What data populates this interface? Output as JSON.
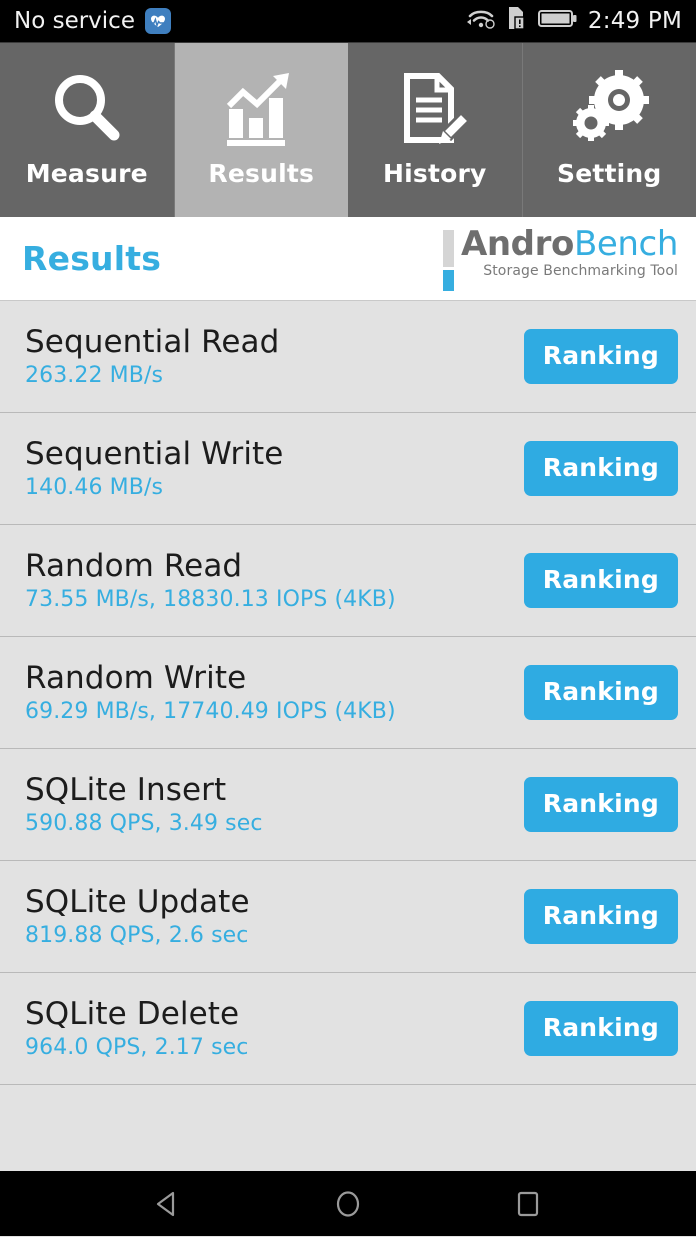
{
  "status_bar": {
    "carrier": "No service",
    "time": "2:49 PM",
    "icons": [
      "heart-rate-badge-icon",
      "wifi-icon",
      "sim-alert-icon",
      "battery-icon"
    ]
  },
  "tabs": [
    {
      "label": "Measure",
      "icon": "magnifier-icon",
      "active": false
    },
    {
      "label": "Results",
      "icon": "bar-chart-trend-icon",
      "active": true
    },
    {
      "label": "History",
      "icon": "document-pencil-icon",
      "active": false
    },
    {
      "label": "Setting",
      "icon": "gears-icon",
      "active": false
    }
  ],
  "header": {
    "title": "Results",
    "logo": {
      "word_primary": "Andro",
      "word_secondary": "Bench",
      "tagline": "Storage Benchmarking Tool"
    }
  },
  "results": [
    {
      "name": "Sequential Read",
      "value": "263.22 MB/s",
      "button": "Ranking"
    },
    {
      "name": "Sequential Write",
      "value": "140.46 MB/s",
      "button": "Ranking"
    },
    {
      "name": "Random Read",
      "value": "73.55 MB/s, 18830.13 IOPS (4KB)",
      "button": "Ranking"
    },
    {
      "name": "Random Write",
      "value": "69.29 MB/s, 17740.49 IOPS (4KB)",
      "button": "Ranking"
    },
    {
      "name": "SQLite Insert",
      "value": "590.88 QPS, 3.49 sec",
      "button": "Ranking"
    },
    {
      "name": "SQLite Update",
      "value": "819.88 QPS, 2.6 sec",
      "button": "Ranking"
    },
    {
      "name": "SQLite Delete",
      "value": "964.0 QPS, 2.17 sec",
      "button": "Ranking"
    }
  ],
  "nav_bar": {
    "back": "back-triangle-icon",
    "home": "home-circle-icon",
    "recents": "recents-square-icon"
  },
  "colors": {
    "accent": "#36aee0",
    "button": "#2fabe2",
    "tab_inactive": "#666666",
    "tab_active": "#b3b3b3",
    "list_bg": "#e2e2e2",
    "status_bg": "#000000"
  }
}
